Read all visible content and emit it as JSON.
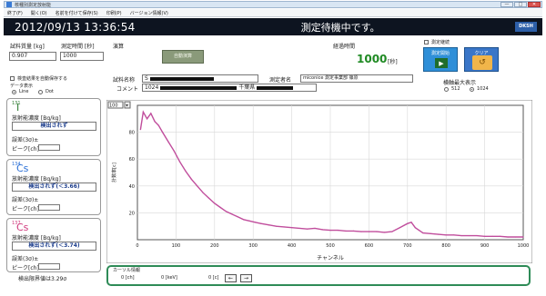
{
  "window": {
    "title": "核種別測定放射能",
    "controls": [
      "—",
      "□",
      "✕"
    ]
  },
  "menu": {
    "items": [
      "終了(F)",
      "開く(O)",
      "名前を付けて保存(S)",
      "印刷(P)",
      "バージョン情報(V)"
    ]
  },
  "status": {
    "datetime": "2012/09/13 13:36:54",
    "message": "測定待機中です。",
    "brand": "DKSH"
  },
  "sample": {
    "weight_label": "試料質量 [kg]",
    "weight_value": "0.907",
    "time_label": "測定時間 [秒]",
    "time_value": "1000",
    "operation_label": "演算",
    "auto_label": "自動演算",
    "elapsed_label": "経過時間",
    "elapsed_value": "1000",
    "elapsed_unit": "[秒]"
  },
  "controls": {
    "continuous_label": "測定継続",
    "start_label": "測定開始",
    "clear_label": "クリア",
    "auto_save_label": "検査結果を自動保存する",
    "display_label": "データ表示",
    "line_label": "Line",
    "dot_label": "Dot",
    "max_label": "横軸最大表示",
    "max_512": "512",
    "max_1024": "1024"
  },
  "info": {
    "sample_name_label": "試料名称",
    "sample_name_value": "S",
    "comment_label": "コメント",
    "comment_value": "1024",
    "comment_suffix": "千葉県",
    "operator_label": "測定者名",
    "operator_value": "miconice 測定事業部 篠原"
  },
  "nuclides": [
    {
      "mass": "131",
      "symbol": "I",
      "conc_label": "放射能濃度 [Bq/kg]",
      "result": "検出されず",
      "error_label": "誤差(3σ)±",
      "peak_label": "ピーク[ch]"
    },
    {
      "mass": "134",
      "symbol": "Cs",
      "conc_label": "放射能濃度 [Bq/kg]",
      "result": "検出されず(＜3.66)",
      "error_label": "誤差(3σ)±",
      "peak_label": "ピーク[ch]"
    },
    {
      "mass": "137",
      "symbol": "Cs",
      "conc_label": "放射能濃度 [Bq/kg]",
      "result": "検出されず(＜3.74)",
      "error_label": "誤差(3σ)±",
      "peak_label": "ピーク[ch]"
    }
  ],
  "detection_limit": "検出限界値は3.29σ",
  "cursor": {
    "title": "カーソル情報",
    "ch": "0 [ch]",
    "kev": "0 [keV]",
    "count": "0 [c]",
    "left_arrow": "←",
    "right_arrow": "→"
  },
  "chart_data": {
    "type": "line",
    "scale_select": "100",
    "xlabel": "チャンネル",
    "ylabel": "計数率[c]",
    "xlim": [
      0,
      1000
    ],
    "ylim": [
      0,
      100
    ],
    "xticks": [
      0,
      100,
      200,
      300,
      400,
      500,
      600,
      700,
      800,
      900,
      1000
    ],
    "yticks": [
      20,
      40,
      60,
      80
    ],
    "grid": true,
    "color": "#c04d9c",
    "x": [
      8,
      15,
      25,
      35,
      45,
      55,
      65,
      80,
      95,
      110,
      125,
      140,
      155,
      170,
      185,
      200,
      215,
      230,
      245,
      260,
      275,
      290,
      305,
      320,
      340,
      360,
      380,
      400,
      420,
      440,
      460,
      480,
      500,
      520,
      540,
      560,
      580,
      600,
      620,
      640,
      660,
      680,
      700,
      710,
      720,
      740,
      760,
      780,
      800,
      820,
      840,
      860,
      880,
      900,
      920,
      940,
      960,
      980,
      1000
    ],
    "y": [
      82,
      95,
      90,
      94,
      88,
      85,
      80,
      73,
      66,
      58,
      51,
      45,
      40,
      35,
      31,
      27,
      24,
      21,
      19,
      17,
      15,
      14,
      13,
      12,
      11,
      10,
      9.5,
      9,
      8.5,
      8,
      8.5,
      7.5,
      7,
      7,
      6.5,
      6.5,
      6,
      6,
      6,
      5.5,
      6,
      9,
      12,
      13,
      9,
      5,
      4.5,
      4,
      3.5,
      3.5,
      3,
      3,
      3,
      2.5,
      2.5,
      2.5,
      2,
      2,
      2
    ]
  }
}
